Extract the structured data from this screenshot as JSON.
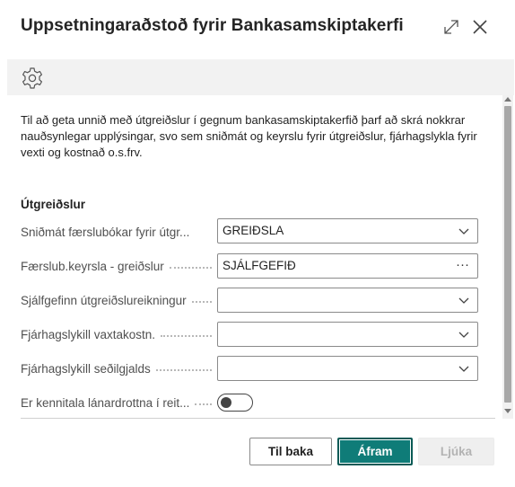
{
  "dialog": {
    "title": "Uppsetningaraðstoð fyrir Bankasamskiptakerfi",
    "expand_icon": "expand-icon",
    "close_icon": "close-icon"
  },
  "toolbar": {
    "settings_icon": "gear-icon"
  },
  "intro_text": "Til að geta unnið með útgreiðslur í gegnum bankasamskiptakerfið þarf að skrá nokkrar nauðsynlegar upplýsingar, svo sem sniðmát og keyrslu fyrir útgreiðslur, fjárhagslykla fyrir vexti og kostnað o.s.frv.",
  "section_title": "Útgreiðslur",
  "fields": [
    {
      "label": "Sniðmát færslubókar fyrir útgr...",
      "value": "GREIÐSLA",
      "control": "dropdown"
    },
    {
      "label": "Færslub.keyrsla - greiðslur",
      "value": "SJÁLFGEFIÐ",
      "control": "lookup"
    },
    {
      "label": "Sjálfgefinn útgreiðslureikningur",
      "value": "",
      "control": "dropdown"
    },
    {
      "label": "Fjárhagslykill vaxtakostn.",
      "value": "",
      "control": "dropdown"
    },
    {
      "label": "Fjárhagslykill seðilgjalds",
      "value": "",
      "control": "dropdown"
    },
    {
      "label": "Er kennitala lánardrottna í reit...",
      "value": "off",
      "control": "toggle"
    }
  ],
  "buttons": {
    "back": "Til baka",
    "next": "Áfram",
    "finish": "Ljúka"
  },
  "colors": {
    "primary": "#0f7c78",
    "primary_border": "#0b5a56",
    "toolbar_bg": "#f2f2f2",
    "disabled_text": "#b3b3b3"
  }
}
